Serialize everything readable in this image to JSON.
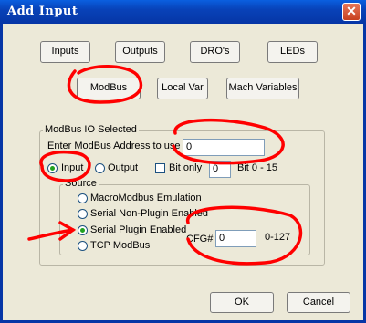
{
  "window": {
    "title": "Add Input",
    "close_label": "✕"
  },
  "top_buttons": [
    "Inputs",
    "Outputs",
    "DRO's",
    "LEDs"
  ],
  "second_buttons": [
    "ModBus",
    "Local Var",
    "Mach Variables"
  ],
  "modbus_group": {
    "label": "ModBus IO Selected",
    "address_label": "Enter ModBus Address to use",
    "address_value": "0",
    "input_label": "Input",
    "output_label": "Output",
    "bit_only_label": "Bit only",
    "bit_value": "0",
    "bit_range": "Bit 0 - 15",
    "selected_direction": "Input"
  },
  "source_group": {
    "label": "Source",
    "options": [
      "MacroModbus Emulation",
      "Serial Non-Plugin Enabled",
      "Serial Plugin Enabled",
      "TCP ModBus"
    ],
    "selected": "Serial Plugin Enabled",
    "cfg_label": "CFG#",
    "cfg_value": "0",
    "cfg_range": "0-127"
  },
  "footer": {
    "ok_label": "OK",
    "cancel_label": "Cancel"
  },
  "annotation_color": "#ff0000"
}
